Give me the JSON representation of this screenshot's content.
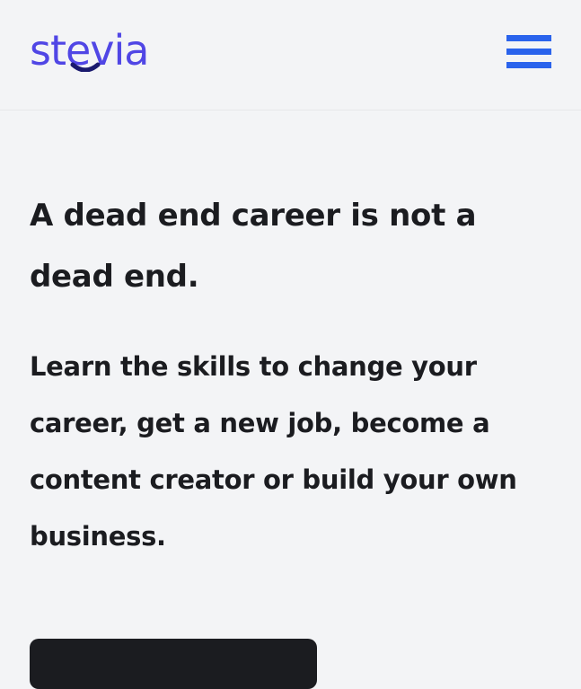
{
  "header": {
    "logo_text": "stevia",
    "brand_color": "#5046e5",
    "accent_color": "#1a1a6e",
    "menu_icon": "hamburger-icon",
    "menu_color": "#2a63ec"
  },
  "hero": {
    "headline": "A dead end career is not a dead end.",
    "subhead": "Learn the skills to change your career, get a new job, become a content creator or build your own business."
  },
  "cta": {
    "label": ""
  }
}
